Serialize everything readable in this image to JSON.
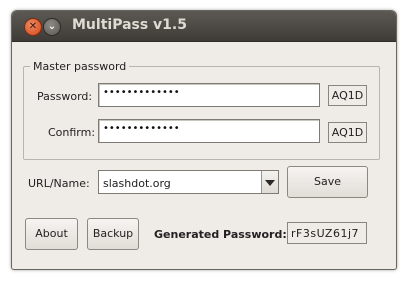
{
  "window": {
    "title": "MultiPass v1.5"
  },
  "titlebar": {
    "close_icon": "close-icon",
    "minimize_icon": "minimize-icon"
  },
  "master": {
    "legend": "Master  password",
    "password_label": "Password:",
    "password_value": "•••••••••••••",
    "password_code": "AQ1D",
    "confirm_label": "Confirm:",
    "confirm_value": "•••••••••••••",
    "confirm_code": "AQ1D"
  },
  "site": {
    "label": "URL/Name:",
    "value": "slashdot.org",
    "save_label": "Save"
  },
  "footer": {
    "about_label": "About",
    "backup_label": "Backup",
    "generated_label": "Generated  Password:",
    "generated_value": "rF3sUZ61j7"
  }
}
